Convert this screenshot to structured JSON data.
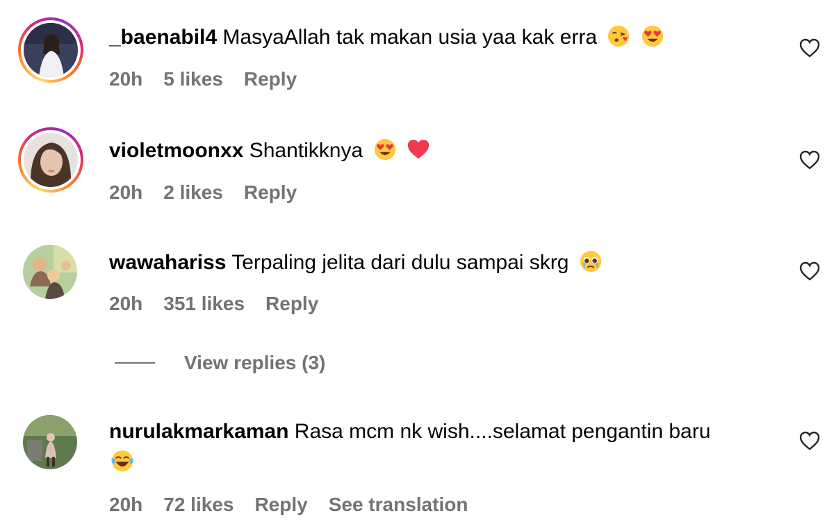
{
  "comments": [
    {
      "username": "_baenabil4",
      "text": "MasyaAllah tak makan usia yaa kak erra",
      "emojis": [
        "face-blowing-kiss",
        "smiling-face-with-heart-eyes"
      ],
      "time": "20h",
      "likes": "5 likes",
      "reply": "Reply",
      "has_story_ring": true
    },
    {
      "username": "violetmoonxx",
      "text": "Shantikknya",
      "emojis": [
        "smiling-face-with-heart-eyes",
        "red-heart"
      ],
      "time": "20h",
      "likes": "2 likes",
      "reply": "Reply",
      "has_story_ring": true
    },
    {
      "username": "wawahariss",
      "text": "Terpaling jelita dari dulu sampai skrg",
      "emojis": [
        "pleading-face-with-tears"
      ],
      "time": "20h",
      "likes": "351 likes",
      "reply": "Reply",
      "has_story_ring": false,
      "view_replies": "View replies (3)"
    },
    {
      "username": "nurulakmarkaman",
      "text": "Rasa mcm nk wish....selamat pengantin baru",
      "emojis": [
        "face-with-tears-of-joy"
      ],
      "time": "20h",
      "likes": "72 likes",
      "reply": "Reply",
      "see_translation": "See translation",
      "has_story_ring": false
    }
  ],
  "colors": {
    "meta_gray": "#737373",
    "ring_start": "#feda75",
    "ring_mid": "#d62976",
    "ring_end": "#962fbf"
  }
}
